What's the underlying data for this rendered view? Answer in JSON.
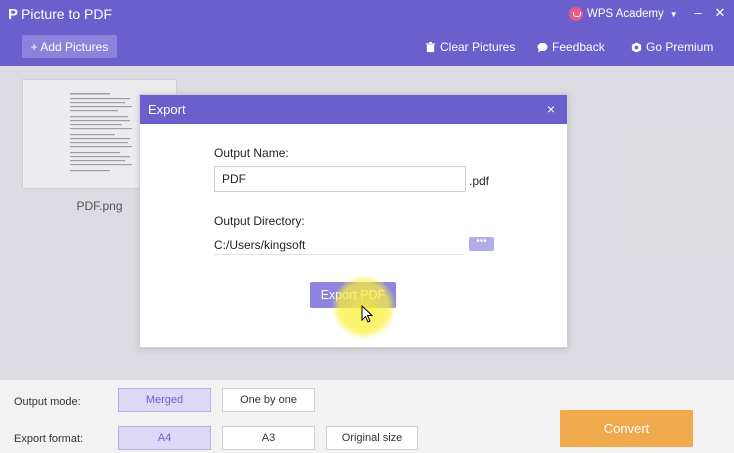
{
  "app": {
    "title": "Picture to PDF",
    "logo": "P",
    "account": "WPS Academy",
    "minimize": "–",
    "close": "✕"
  },
  "toolbar": {
    "add_label": "+ Add Pictures",
    "clear_label": "Clear Pictures",
    "feedback_label": "Feedback",
    "premium_label": "Go Premium"
  },
  "thumbnail": {
    "filename": "PDF.png"
  },
  "dialog": {
    "title": "Export",
    "close": "×",
    "output_name_label": "Output Name:",
    "output_name_value": "PDF",
    "extension": ".pdf",
    "output_dir_label": "Output Directory:",
    "output_dir_value": "C:/Users/kingsoft",
    "browse_label": "•••",
    "export_label": "Export PDF"
  },
  "options": {
    "output_mode_label": "Output mode:",
    "output_modes": [
      "Merged",
      "One by one"
    ],
    "output_mode_selected": "Merged",
    "export_format_label": "Export format:",
    "export_formats": [
      "A4",
      "A3",
      "Original size"
    ],
    "export_format_selected": "A4",
    "convert_label": "Convert"
  },
  "colors": {
    "primary": "#6b5fce",
    "convert": "#f0a94c",
    "highlight": "#faf03c"
  }
}
